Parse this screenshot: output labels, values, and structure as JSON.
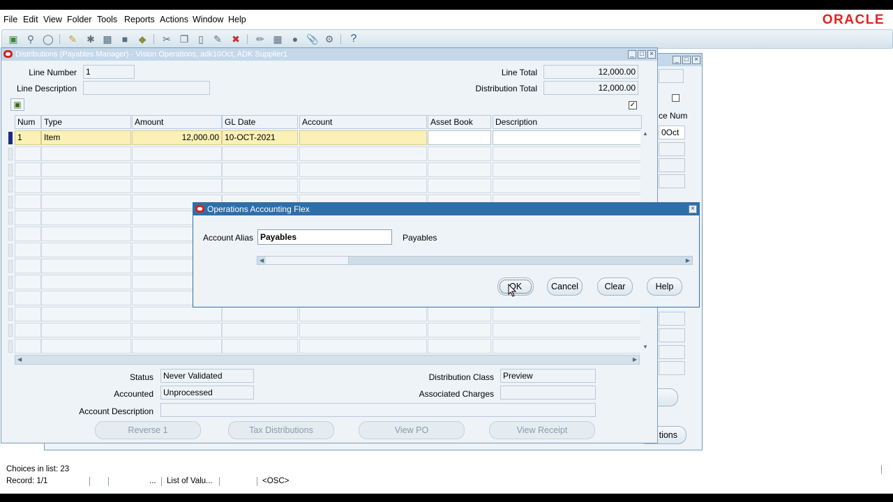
{
  "menu": [
    "File",
    "Edit",
    "View",
    "Folder",
    "Tools",
    "Reports",
    "Actions",
    "Window",
    "Help"
  ],
  "brand": "ORACLE",
  "toolbar_icons": [
    "new-icon",
    "find-icon",
    "navigator-icon",
    "save-icon",
    "next-step-icon",
    "print-icon",
    "close-form-icon",
    "cut-icon",
    "copy-icon",
    "paste-icon",
    "clear-record-icon",
    "delete-icon",
    "edit-field-icon",
    "zoom-icon",
    "translations-icon",
    "attachments-icon",
    "folder-tools-icon",
    "help-icon"
  ],
  "dist_window": {
    "title": "Distributions (Payables Manager) - Vision Operations, adk10Oct, ADK Supplier1",
    "line_number_label": "Line Number",
    "line_number": "1",
    "line_description_label": "Line Description",
    "line_description": "",
    "line_total_label": "Line Total",
    "line_total": "12,000.00",
    "distribution_total_label": "Distribution Total",
    "distribution_total": "12,000.00",
    "columns": [
      "Num",
      "Type",
      "Amount",
      "GL Date",
      "Account",
      "Asset Book",
      "Description"
    ],
    "rows": [
      {
        "num": "1",
        "type": "Item",
        "amount": "12,000.00",
        "gl_date": "10-OCT-2021",
        "account": "",
        "asset_book": "",
        "description": ""
      }
    ],
    "status_label": "Status",
    "status": "Never Validated",
    "accounted_label": "Accounted",
    "accounted": "Unprocessed",
    "account_description_label": "Account Description",
    "account_description": "",
    "distribution_class_label": "Distribution Class",
    "distribution_class": "Preview",
    "associated_charges_label": "Associated Charges",
    "associated_charges": "",
    "buttons": {
      "reverse": "Reverse 1",
      "tax_distributions": "Tax Distributions",
      "view_po": "View PO",
      "view_receipt": "View Receipt"
    }
  },
  "back_window": {
    "col_fragment": "ce Num",
    "value_fragment": "0Oct",
    "button_fragment": "tions"
  },
  "flex_dialog": {
    "title": "Operations Accounting Flex",
    "alias_label": "Account Alias",
    "alias_value": "Payables",
    "alias_description": "Payables",
    "buttons": {
      "ok": "OK",
      "cancel": "Cancel",
      "clear": "Clear",
      "help": "Help"
    }
  },
  "statusbar": {
    "message": "Choices in list: 23",
    "record": "Record: 1/1",
    "ellipsis": "...",
    "lov": "List of Valu...",
    "osc": "<OSC>"
  }
}
